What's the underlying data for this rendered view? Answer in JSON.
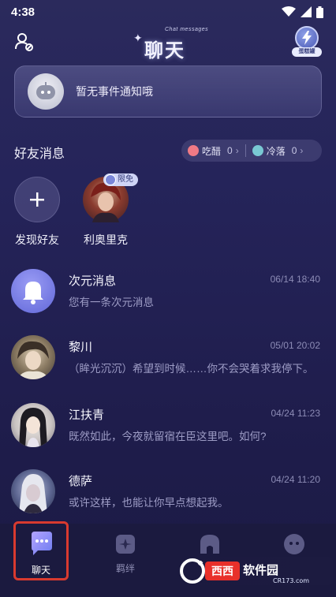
{
  "status_bar": {
    "time": "4:38"
  },
  "header": {
    "title": "聊天",
    "subtitle": "Chat messages",
    "energy_label": "蛋糕罐"
  },
  "notice": {
    "text": "暂无事件通知哦"
  },
  "friends_section": {
    "title": "好友消息",
    "filters": [
      {
        "label": "吃醋",
        "count": "0"
      },
      {
        "label": "冷落",
        "count": "0"
      }
    ],
    "add_friend": {
      "label": "发现好友"
    },
    "friends": [
      {
        "name": "利奥里克",
        "badge": "限免"
      }
    ]
  },
  "conversations": [
    {
      "name": "次元消息",
      "time": "06/14 18:40",
      "message": "您有一条次元消息",
      "avatar": "bell-icon"
    },
    {
      "name": "黎川",
      "time": "05/01 20:02",
      "message": "（眸光沉沉）希望到时候……你不会哭着求我停下。",
      "avatar": "portrait"
    },
    {
      "name": "江扶青",
      "time": "04/24 11:23",
      "message": "既然如此，今夜就留宿在臣这里吧。如何?",
      "avatar": "portrait"
    },
    {
      "name": "德萨",
      "time": "04/24 11:20",
      "message": "或许这样，也能让你早点想起我。",
      "avatar": "portrait"
    }
  ],
  "bottom_nav": [
    {
      "label": "聊天",
      "icon": "chat-bubble-icon",
      "active": true
    },
    {
      "label": "羁绊",
      "icon": "bond-icon",
      "active": false
    },
    {
      "label": "",
      "icon": "house-icon",
      "active": false
    },
    {
      "label": "",
      "icon": "face-icon",
      "active": false
    }
  ],
  "watermark": {
    "text": "西西软件园",
    "domain": "CR173.com"
  },
  "colors": {
    "background": "#24235a",
    "accent_purple": "#6e73e6",
    "active_outline": "#d93a2f"
  }
}
